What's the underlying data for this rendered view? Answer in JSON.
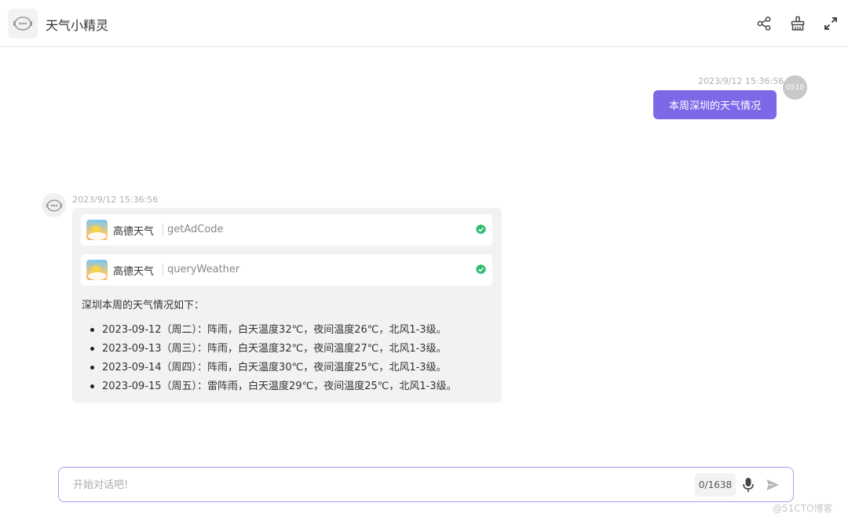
{
  "header": {
    "title": "天气小精灵",
    "icons": [
      "robot-icon",
      "share-icon",
      "clear-icon",
      "expand-icon"
    ]
  },
  "messages": {
    "user": {
      "time": "2023/9/12 15:36:56",
      "avatar_text": "0510",
      "text": "本周深圳的天气情况"
    },
    "bot": {
      "time": "2023/9/12 15:36:56",
      "tools": [
        {
          "name": "高德天气",
          "function": "getAdCode",
          "status": "success"
        },
        {
          "name": "高德天气",
          "function": "queryWeather",
          "status": "success"
        }
      ],
      "intro": "深圳本周的天气情况如下：",
      "forecast": [
        "2023-09-12（周二）：阵雨，白天温度32℃，夜间温度26℃，北风1-3级。",
        "2023-09-13（周三）：阵雨，白天温度32℃，夜间温度27℃，北风1-3级。",
        "2023-09-14（周四）：阵雨，白天温度30℃，夜间温度25℃，北风1-3级。",
        "2023-09-15（周五）：雷阵雨，白天温度29℃，夜间温度25℃，北风1-3级。"
      ]
    }
  },
  "input": {
    "placeholder": "开始对话吧!",
    "value": "",
    "counter": "0/1638"
  },
  "watermark": "@51CTO博客",
  "colors": {
    "accent": "#7b69e8",
    "input_border": "#a79cf0",
    "success": "#2dbd6e",
    "bubble_bg": "#f2f2f2"
  }
}
